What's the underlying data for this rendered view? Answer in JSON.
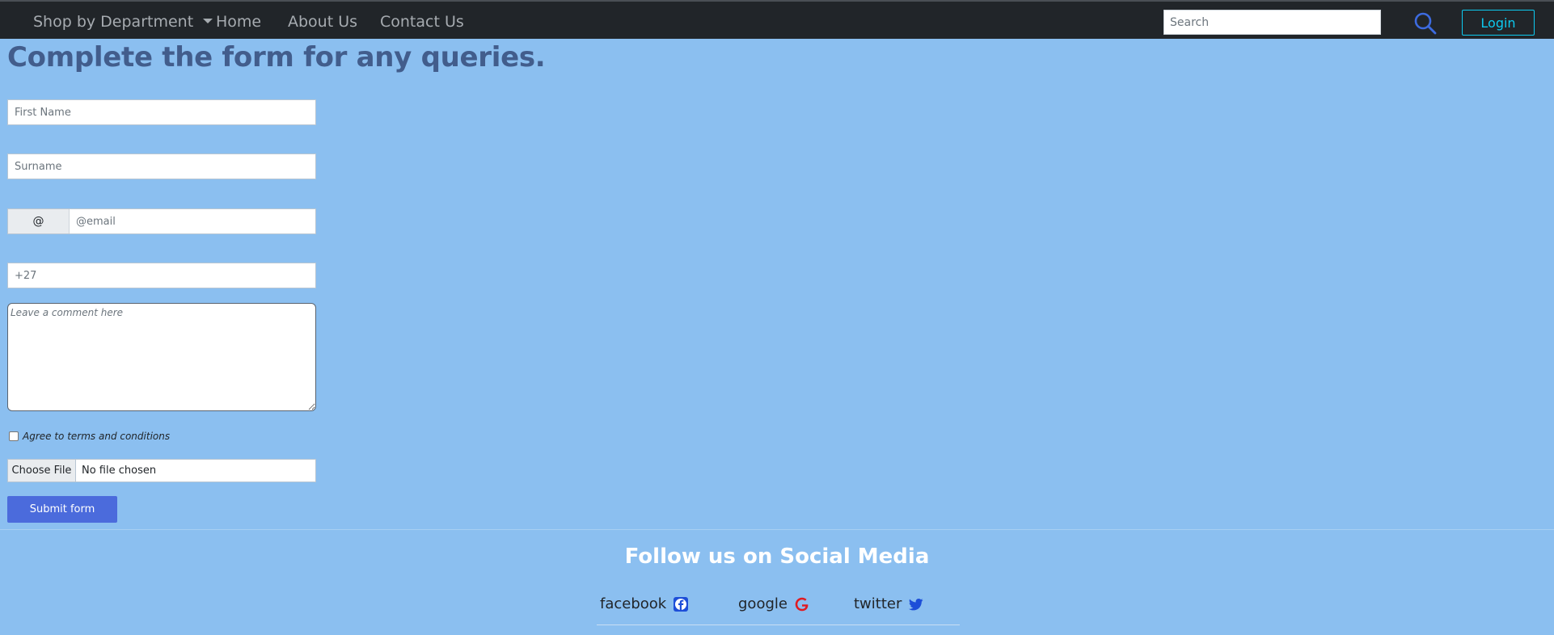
{
  "navbar": {
    "dropdown_label": "Shop by Department",
    "links": [
      "Home",
      "About Us",
      "Contact Us"
    ],
    "search_placeholder": "Search",
    "login_label": "Login"
  },
  "form": {
    "title": "Complete the form for any queries.",
    "first_name_placeholder": "First Name",
    "surname_placeholder": "Surname",
    "email_addon": "@",
    "email_placeholder": "@email",
    "phone_placeholder": "+27",
    "comment_placeholder": "Leave a comment here",
    "terms_label": "Agree to terms and conditions",
    "file_button_label": "Choose File",
    "file_status": "No file chosen",
    "submit_label": "Submit form"
  },
  "footer": {
    "title": "Follow us on Social Media",
    "social": [
      {
        "label": "facebook",
        "icon": "facebook-icon",
        "color": "#1877f2"
      },
      {
        "label": "google",
        "icon": "google-icon",
        "color": "#e01b22"
      },
      {
        "label": "twitter",
        "icon": "twitter-icon",
        "color": "#1d4ed8"
      }
    ]
  }
}
